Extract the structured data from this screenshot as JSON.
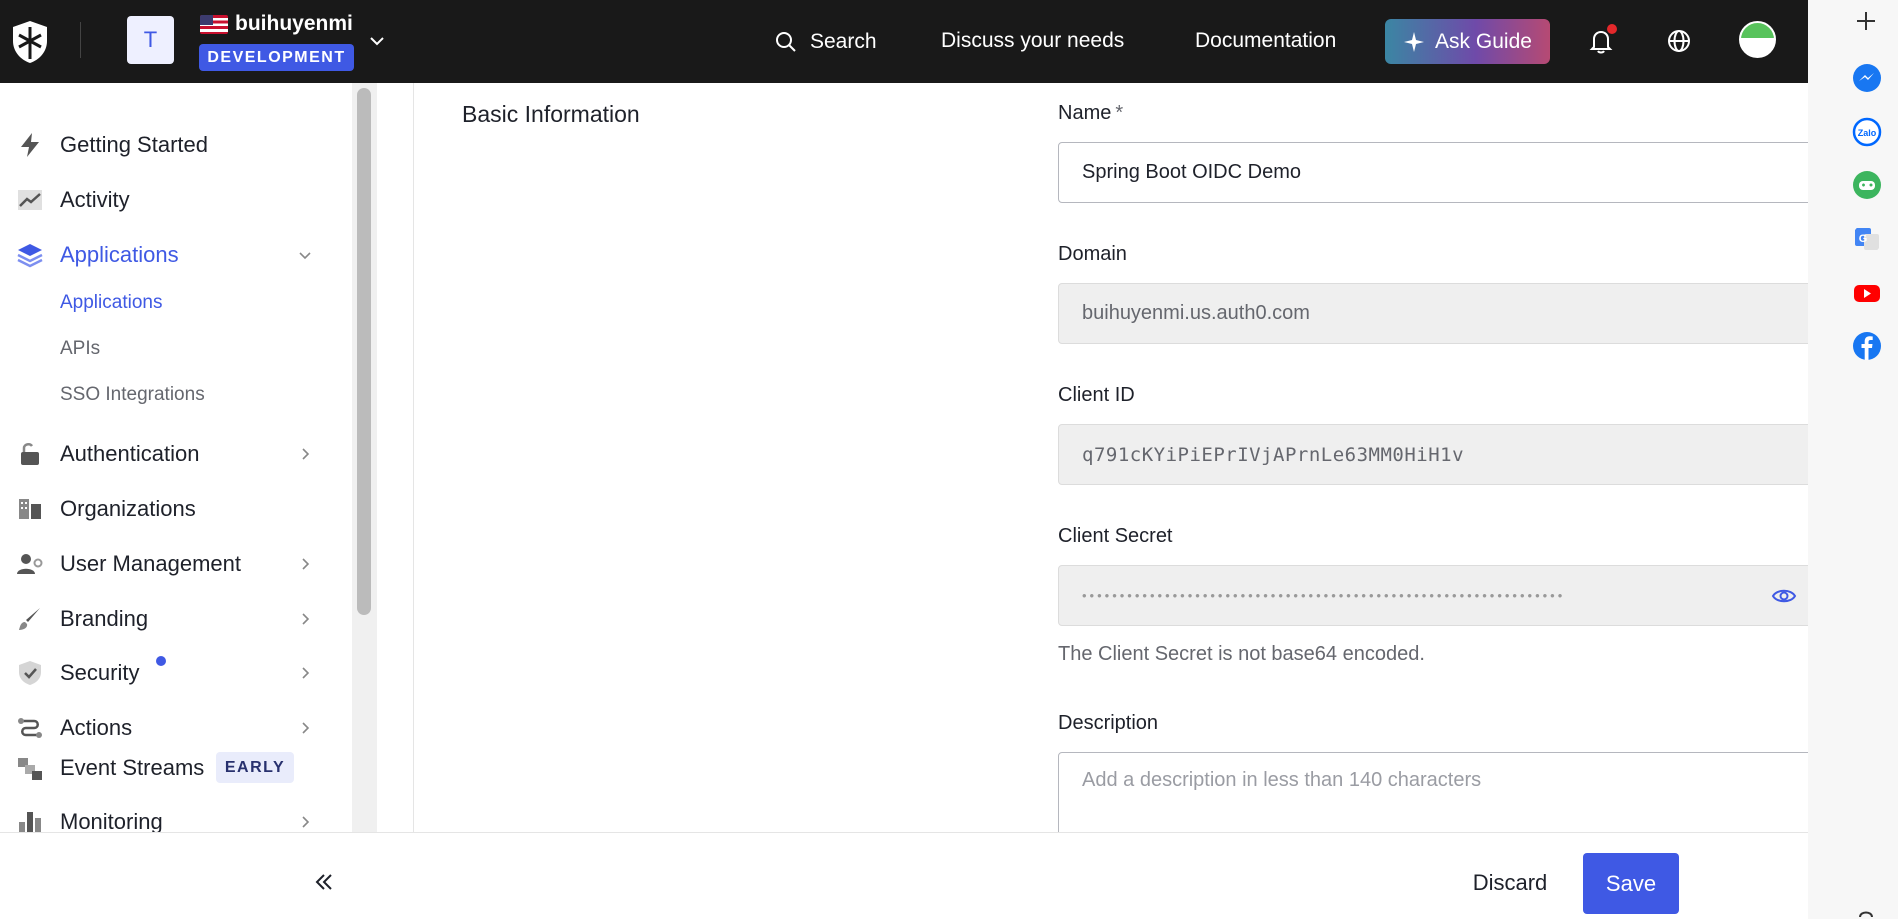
{
  "topbar": {
    "tenant_initial": "T",
    "tenant_name": "buihuyenmi",
    "environment": "DEVELOPMENT",
    "search_label": "Search",
    "discuss_label": "Discuss your needs",
    "docs_label": "Documentation",
    "ask_guide_label": "Ask Guide"
  },
  "sidebar": {
    "items": [
      {
        "label": "Getting Started",
        "icon": "lightning-icon"
      },
      {
        "label": "Activity",
        "icon": "trending-icon"
      },
      {
        "label": "Applications",
        "icon": "layers-icon",
        "active": true,
        "expanded": true
      },
      {
        "label": "Authentication",
        "icon": "lock-icon"
      },
      {
        "label": "Organizations",
        "icon": "building-icon"
      },
      {
        "label": "User Management",
        "icon": "users-gear-icon"
      },
      {
        "label": "Branding",
        "icon": "brush-icon"
      },
      {
        "label": "Security",
        "icon": "shield-check-icon"
      },
      {
        "label": "Actions",
        "icon": "flow-icon"
      },
      {
        "label": "Event Streams",
        "icon": "streams-icon",
        "badge": "EARLY"
      },
      {
        "label": "Monitoring",
        "icon": "bar-chart-icon"
      }
    ],
    "sub_items": [
      {
        "label": "Applications",
        "active": true
      },
      {
        "label": "APIs"
      },
      {
        "label": "SSO Integrations"
      }
    ]
  },
  "main": {
    "section_title": "Basic Information",
    "name_label": "Name",
    "name_required": "*",
    "name_value": "Spring Boot OIDC Demo",
    "domain_label": "Domain",
    "domain_value": "buihuyenmi.us.auth0.com",
    "client_id_label": "Client ID",
    "client_id_value": "q791cKYiPiEPrIVjAPrnLe63MM0HiH1v",
    "client_secret_label": "Client Secret",
    "client_secret_value": "••••••••••••••••••••••••••••••••••••••••••••••••••••••••••••••••",
    "client_secret_help": "The Client Secret is not base64 encoded.",
    "description_label": "Description",
    "description_placeholder": "Add a description in less than 140 characters"
  },
  "footer": {
    "discard_label": "Discard",
    "save_label": "Save"
  },
  "colors": {
    "accent": "#3f59e4",
    "topbar_bg": "#191919"
  }
}
